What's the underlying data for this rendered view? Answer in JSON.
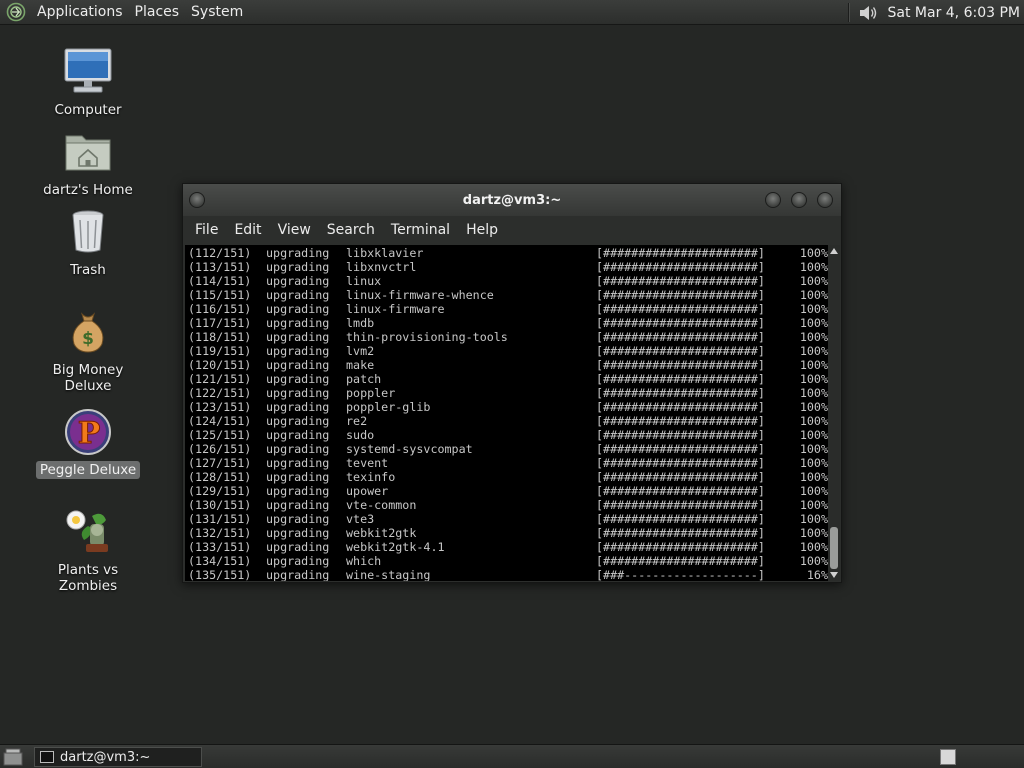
{
  "top_panel": {
    "menus": [
      "Applications",
      "Places",
      "System"
    ],
    "clock": "Sat Mar  4,  6:03 PM"
  },
  "desktop": {
    "icons": [
      {
        "label": "Computer",
        "icon": "computer-icon"
      },
      {
        "label": "dartz's Home",
        "icon": "home-folder-icon"
      },
      {
        "label": "Trash",
        "icon": "trash-icon"
      },
      {
        "label": "Big Money Deluxe",
        "icon": "money-bag-icon"
      },
      {
        "label": "Peggle Deluxe",
        "icon": "peggle-icon",
        "selected": true
      },
      {
        "label": "Plants vs Zombies",
        "icon": "plants-vs-zombies-icon"
      }
    ]
  },
  "terminal": {
    "title": "dartz@vm3:~",
    "menus": [
      "File",
      "Edit",
      "View",
      "Search",
      "Terminal",
      "Help"
    ],
    "lines": [
      {
        "idx": "(112/151)",
        "action": "upgrading",
        "package": "libxklavier",
        "bar": "[######################]",
        "pct": "100%"
      },
      {
        "idx": "(113/151)",
        "action": "upgrading",
        "package": "libxnvctrl",
        "bar": "[######################]",
        "pct": "100%"
      },
      {
        "idx": "(114/151)",
        "action": "upgrading",
        "package": "linux",
        "bar": "[######################]",
        "pct": "100%"
      },
      {
        "idx": "(115/151)",
        "action": "upgrading",
        "package": "linux-firmware-whence",
        "bar": "[######################]",
        "pct": "100%"
      },
      {
        "idx": "(116/151)",
        "action": "upgrading",
        "package": "linux-firmware",
        "bar": "[######################]",
        "pct": "100%"
      },
      {
        "idx": "(117/151)",
        "action": "upgrading",
        "package": "lmdb",
        "bar": "[######################]",
        "pct": "100%"
      },
      {
        "idx": "(118/151)",
        "action": "upgrading",
        "package": "thin-provisioning-tools",
        "bar": "[######################]",
        "pct": "100%"
      },
      {
        "idx": "(119/151)",
        "action": "upgrading",
        "package": "lvm2",
        "bar": "[######################]",
        "pct": "100%"
      },
      {
        "idx": "(120/151)",
        "action": "upgrading",
        "package": "make",
        "bar": "[######################]",
        "pct": "100%"
      },
      {
        "idx": "(121/151)",
        "action": "upgrading",
        "package": "patch",
        "bar": "[######################]",
        "pct": "100%"
      },
      {
        "idx": "(122/151)",
        "action": "upgrading",
        "package": "poppler",
        "bar": "[######################]",
        "pct": "100%"
      },
      {
        "idx": "(123/151)",
        "action": "upgrading",
        "package": "poppler-glib",
        "bar": "[######################]",
        "pct": "100%"
      },
      {
        "idx": "(124/151)",
        "action": "upgrading",
        "package": "re2",
        "bar": "[######################]",
        "pct": "100%"
      },
      {
        "idx": "(125/151)",
        "action": "upgrading",
        "package": "sudo",
        "bar": "[######################]",
        "pct": "100%"
      },
      {
        "idx": "(126/151)",
        "action": "upgrading",
        "package": "systemd-sysvcompat",
        "bar": "[######################]",
        "pct": "100%"
      },
      {
        "idx": "(127/151)",
        "action": "upgrading",
        "package": "tevent",
        "bar": "[######################]",
        "pct": "100%"
      },
      {
        "idx": "(128/151)",
        "action": "upgrading",
        "package": "texinfo",
        "bar": "[######################]",
        "pct": "100%"
      },
      {
        "idx": "(129/151)",
        "action": "upgrading",
        "package": "upower",
        "bar": "[######################]",
        "pct": "100%"
      },
      {
        "idx": "(130/151)",
        "action": "upgrading",
        "package": "vte-common",
        "bar": "[######################]",
        "pct": "100%"
      },
      {
        "idx": "(131/151)",
        "action": "upgrading",
        "package": "vte3",
        "bar": "[######################]",
        "pct": "100%"
      },
      {
        "idx": "(132/151)",
        "action": "upgrading",
        "package": "webkit2gtk",
        "bar": "[######################]",
        "pct": "100%"
      },
      {
        "idx": "(133/151)",
        "action": "upgrading",
        "package": "webkit2gtk-4.1",
        "bar": "[######################]",
        "pct": "100%"
      },
      {
        "idx": "(134/151)",
        "action": "upgrading",
        "package": "which",
        "bar": "[######################]",
        "pct": "100%"
      },
      {
        "idx": "(135/151)",
        "action": "upgrading",
        "package": "wine-staging",
        "bar": "[###-------------------]",
        "pct": "16%"
      }
    ]
  },
  "bottom_panel": {
    "task": "dartz@vm3:~"
  }
}
